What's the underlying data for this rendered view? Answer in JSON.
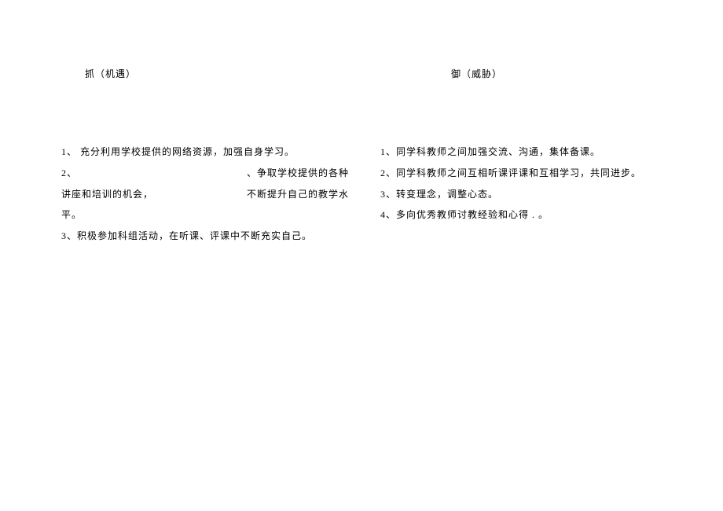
{
  "left": {
    "heading": "抓（机遇）",
    "item1": "1、  充分利用学校提供的网络资源，加强自身学习。",
    "item2_prefix": "2、",
    "item2_right": "、争取学校提供的各种",
    "item2_line2a": "讲座和培训的机会，",
    "item2_line2b": "不断提升自己的教学水",
    "item2_line3": "平。",
    "item3": "3、积极参加科组活动，在听课、评课中不断充实自己。"
  },
  "right": {
    "heading": "御（威胁）",
    "item1": "1、同学科教师之间加强交流、沟通，集体备课。",
    "item2": "2、同学科教师之间互相听课评课和互相学习，共同进步。",
    "item3": "3、转变理念，调整心态。",
    "item4": "4、多向优秀教师讨教经验和心得  . 。"
  }
}
